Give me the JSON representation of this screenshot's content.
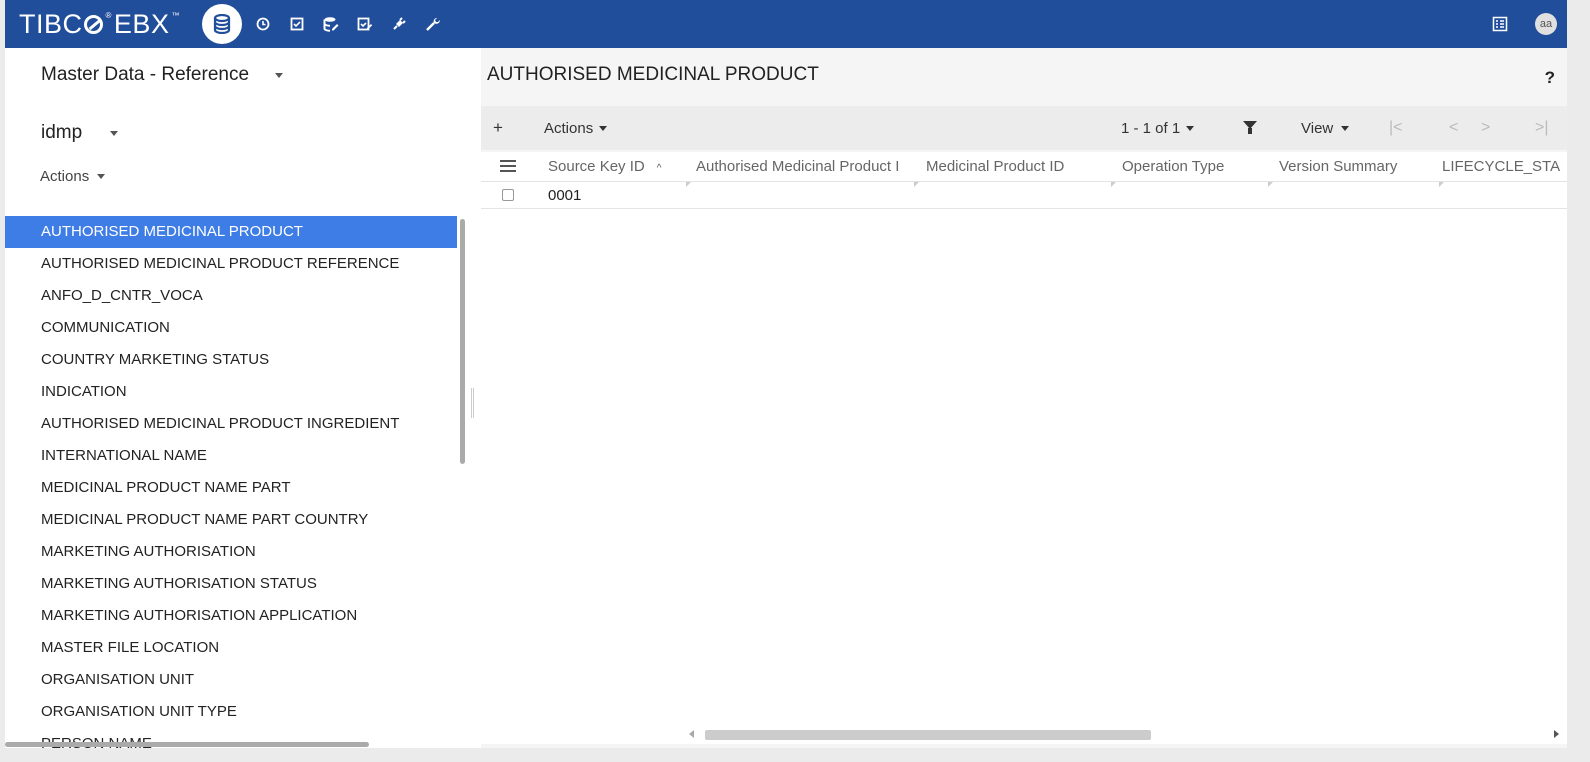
{
  "app": {
    "logo_text_left": "TIBC",
    "logo_text_right": "EBX",
    "logo_tm": "™",
    "avatar_initials": "aa"
  },
  "topbar_icons": [
    "database-icon",
    "clock-icon",
    "checkbox-icon",
    "data-edit-icon",
    "task-check-icon",
    "plug-icon",
    "wrench-icon"
  ],
  "left": {
    "dataspace": "Master Data - Reference",
    "dataset": "idmp",
    "actions_label": "Actions",
    "tables": [
      "AUTHORISED MEDICINAL PRODUCT",
      "AUTHORISED MEDICINAL PRODUCT REFERENCE",
      "ANFO_D_CNTR_VOCA",
      "COMMUNICATION",
      "COUNTRY MARKETING STATUS",
      "INDICATION",
      "AUTHORISED MEDICINAL PRODUCT INGREDIENT",
      "INTERNATIONAL NAME",
      "MEDICINAL PRODUCT NAME PART",
      "MEDICINAL PRODUCT NAME PART COUNTRY",
      "MARKETING AUTHORISATION",
      "MARKETING AUTHORISATION STATUS",
      "MARKETING AUTHORISATION APPLICATION",
      "MASTER FILE LOCATION",
      "ORGANISATION UNIT",
      "ORGANISATION UNIT TYPE",
      "PERSON NAME"
    ],
    "selected_index": 0
  },
  "right": {
    "title": "AUTHORISED MEDICINAL PRODUCT",
    "help": "?",
    "toolbar": {
      "add": "+",
      "actions_label": "Actions",
      "pager": "1 - 1 of 1",
      "view_label": "View",
      "first": "|<",
      "prev": "<",
      "next": ">",
      "last": ">|"
    },
    "columns": [
      "Source Key ID",
      "Authorised Medicinal Product I",
      "Medicinal Product ID",
      "Operation Type",
      "Version Summary",
      "LIFECYCLE_STA"
    ],
    "rows": [
      {
        "source_key_id": "0001"
      }
    ]
  }
}
